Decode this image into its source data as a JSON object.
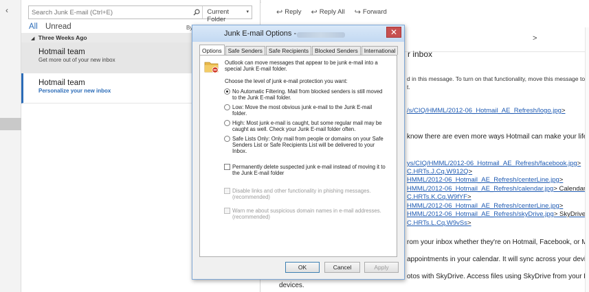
{
  "search": {
    "placeholder": "Search Junk E-mail (Ctrl+E)",
    "scope": "Current Folder"
  },
  "filters": {
    "all": "All",
    "unread": "Unread",
    "sort": "By"
  },
  "group": {
    "label": "Three Weeks Ago"
  },
  "messages": [
    {
      "sender": "Hotmail team",
      "preview": "Get more out of your new inbox"
    },
    {
      "sender": "Hotmail team",
      "preview": "Personalize your new inbox"
    }
  ],
  "reading": {
    "reply": "Reply",
    "reply_all": "Reply All",
    "forward": "Forward",
    "subject_fragment": "r inbox",
    "arrow": ">",
    "body_lines": [
      "d in this message. To turn on that functionality, move this message to",
      "t."
    ],
    "link1": "/s/CIQ/HMML/2012-06_Hotmail_AE_Refresh/logo.jpg",
    "link1_suffix": ">",
    "line_know": "know there are even more ways Hotmail can make your life",
    "links": [
      {
        "text": "ys/CIQ/HMML/2012-06_Hotmail_AE_Refresh/facebook.jpg",
        "suffix": ">"
      },
      {
        "text": "C.HRTs.J.Cq.W912Q",
        "suffix": ">"
      },
      {
        "text": "HMML/2012-06_Hotmail_AE_Refresh/centerLine.jpg",
        "suffix": ">"
      },
      {
        "text": "HMML/2012-06_Hotmail_AE_Refresh/calendar.jpg",
        "suffix": "> Calendar"
      },
      {
        "text": "C.HRTs.K.Cq.W9fYF",
        "suffix": ">"
      },
      {
        "text": "HMML/2012-06_Hotmail_AE_Refresh/centerLine.jpg",
        "suffix": ">"
      },
      {
        "text": "HMML/2012-06_Hotmail_AE_Refresh/skyDrive.jpg",
        "suffix": "> SkyDrive"
      },
      {
        "text": "C.HRTs.L.Cq.W9vSs",
        "suffix": ">"
      }
    ],
    "line_from": "rom your inbox whether they're on Hotmail, Facebook, or Me",
    "line_appts": "appointments in your calendar. It will sync across your devices",
    "line_photos": "otos with SkyDrive. Access files using SkyDrive from your Hot",
    "line_devices": "devices."
  },
  "dialog": {
    "title": "Junk E-mail Options -",
    "close": "✕",
    "tabs": [
      "Options",
      "Safe Senders",
      "Safe Recipients",
      "Blocked Senders",
      "International"
    ],
    "intro_line1": "Outlook can move messages that appear to be junk e-mail into a",
    "intro_line2": "special Junk E-mail folder.",
    "choose": "Choose the level of junk e-mail protection you want:",
    "opt_none_1": "No Automatic Filtering. Mail from blocked senders is still moved",
    "opt_none_2": "to the Junk E-mail folder.",
    "opt_low_1": "Low: Move the most obvious junk e-mail to the Junk E-mail",
    "opt_low_2": "folder.",
    "opt_high_1": "High: Most junk e-mail is caught, but some regular mail may be",
    "opt_high_2": "caught as well. Check your Junk E-mail folder often.",
    "opt_safe_1": "Safe Lists Only: Only mail from people or domains on your Safe",
    "opt_safe_2": "Senders List or Safe Recipients List will be delivered to your",
    "opt_safe_3": "Inbox.",
    "perm_1": "Permanently delete suspected junk e-mail instead of moving it to",
    "perm_2": "the Junk E-mail folder",
    "disable_1": "Disable links and other functionality in phishing messages.",
    "disable_2": "(recommended)",
    "warn_1": "Warn me about suspicious domain names in e-mail addresses.",
    "warn_2": "(recommended)",
    "ok": "OK",
    "cancel": "Cancel",
    "apply": "Apply"
  },
  "colors": {
    "accent": "#2b6cb8",
    "link": "#1f5bb3",
    "close": "#c75050"
  }
}
